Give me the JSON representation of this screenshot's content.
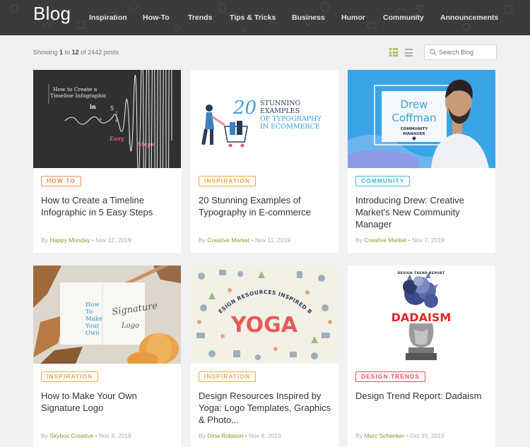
{
  "header": {
    "logo": "Blog",
    "nav": [
      "Inspiration",
      "How-To",
      "Trends",
      "Tips & Tricks",
      "Business",
      "Humor",
      "Community",
      "Announcements"
    ]
  },
  "toolbar": {
    "showing_prefix": "Showing",
    "range_start": "1",
    "range_to": "to",
    "range_end": "12",
    "range_of": "of",
    "total": "2442 posts",
    "search_placeholder": "Search Blog"
  },
  "colors": {
    "brand_green": "#7e9f2c",
    "how_to": "#f08a54",
    "inspiration": "#f0a84a",
    "community": "#45b8d4",
    "design_trends": "#e0525a"
  },
  "posts": [
    {
      "tag": "How To",
      "title": "How to Create a Timeline Infographic in 5 Easy Steps",
      "by": "By",
      "author": "Happy Monday",
      "date": "Nov 12, 2019",
      "image": {
        "line1": "How to Create a",
        "line2": "Timeline Infographic",
        "in": "in",
        "five": "5",
        "easy": "Easy",
        "steps": "Steps"
      }
    },
    {
      "tag": "Inspiration",
      "title": "20 Stunning Examples of Typography in E-commerce",
      "by": "By",
      "author": "Creative Market",
      "date": "Nov 11, 2019",
      "image": {
        "num": "20",
        "line1": "STUNNING",
        "line2": "EXAMPLES",
        "line3": "OF TYPOGRAPHY",
        "line4": "IN ECOMMERCE"
      }
    },
    {
      "tag": "Community",
      "title": "Introducing Drew: Creative Market's New Community Manager",
      "by": "By",
      "author": "Creative Market",
      "date": "Nov 7, 2019",
      "image": {
        "first": "Drew",
        "last": "Coffman",
        "role1": "COMMUNITY",
        "role2": "MANAGER"
      }
    },
    {
      "tag": "Inspiration",
      "title": "How to Make Your Own Signature Logo",
      "by": "By",
      "author": "Skybox Creative",
      "date": "Nov 8, 2019",
      "image": {
        "left": [
          "How",
          "To",
          "Make",
          "Your",
          "Own"
        ],
        "script1": "Signature",
        "script2": "Logo"
      }
    },
    {
      "tag": "Inspiration",
      "title": "Design Resources Inspired by Yoga: Logo Templates, Graphics & Photo...",
      "by": "By",
      "author": "Dina Robison",
      "date": "Nov 8, 2019",
      "image": {
        "arc": "DESIGN RESOURCES INSPIRED BY",
        "word": "YOGA"
      }
    },
    {
      "tag": "Design Trends",
      "title": "Design Trend Report: Dadaism",
      "by": "By",
      "author": "Marc Schenker",
      "date": "Oct 30, 2019",
      "image": {
        "kicker": "DESIGN TREND REPORT",
        "word": "DADAISM"
      }
    }
  ]
}
